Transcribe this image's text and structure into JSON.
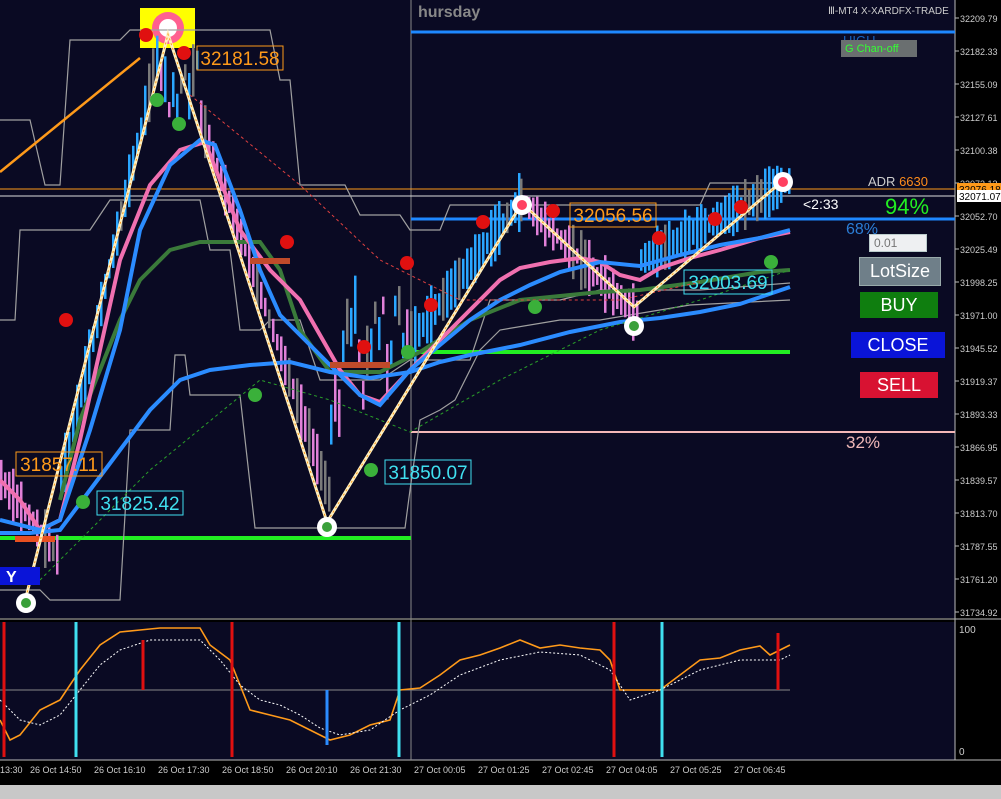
{
  "header": {
    "day_label": "hursday",
    "brand": "Ⅲ-MT4 X-XARDFX-TRADE"
  },
  "price_axis": {
    "labels": [
      "32209.79",
      "32182.33",
      "32155.09",
      "32127.61",
      "32100.38",
      "32073.13",
      "32052.70",
      "32025.49",
      "31998.25",
      "31971.00",
      "31945.52",
      "31919.37",
      "31893.33",
      "31866.95",
      "31839.57",
      "31813.70",
      "31787.55",
      "31761.20",
      "31734.92"
    ],
    "highlight_label": "32076.18",
    "current_label": "32071.07"
  },
  "indicator_axis": {
    "top_label": "100",
    "bottom_label": "0"
  },
  "time_axis": {
    "labels": [
      "13:30",
      "26 Oct 14:50",
      "26 Oct 16:10",
      "26 Oct 17:30",
      "26 Oct 18:50",
      "26 Oct 20:10",
      "26 Oct 21:30",
      "27 Oct 00:05",
      "27 Oct 01:25",
      "27 Oct 02:45",
      "27 Oct 04:05",
      "27 Oct 05:25",
      "27 Oct 06:45"
    ]
  },
  "price_labels": {
    "high_1": "32181.58",
    "high_2": "32056.56",
    "low_left": "31857.11",
    "low_1": "31825.42",
    "low_2": "31850.07",
    "low_3": "32003.69"
  },
  "panel": {
    "adr_label": "ADR",
    "adr_value": "6630",
    "timer": "<2:33",
    "pct_top": "94%",
    "pct_mid": "68%",
    "pct_low": "32%",
    "high_text": "HIGH",
    "chan_badge": "G  Chan-off",
    "lot_placeholder": "0.01",
    "lotsize_label": "LotSize",
    "buy_label": "BUY",
    "close_label": "CLOSE",
    "sell_label": "SELL",
    "left_tag": "Y"
  },
  "colors": {
    "background": "#000000",
    "chart_bg": "#0a0a23",
    "up_bar": "#2aa6ff",
    "down_bar": "#e080d8",
    "neutral_bar": "#7a7a7a",
    "zigzag": "#fff0c0",
    "ma_fast": "#f070b0",
    "ma_slow": "#2b8cff",
    "ma_green": "#3a7a3a",
    "support_line": "#22ee22",
    "resistance_line": "#1e88ff",
    "pivot_line": "#f4b8b8",
    "envelope": "#a0a0a0",
    "orange_line": "#ff9a1a"
  },
  "chart_data": {
    "type": "line",
    "title": "",
    "ylim": [
      31734.92,
      32209.79
    ],
    "zigzag_points": [
      {
        "x": "26 Oct 13:30",
        "y": 31750
      },
      {
        "x": "26 Oct 17:05",
        "y": 32200
      },
      {
        "x": "26 Oct 20:20",
        "y": 31810
      },
      {
        "x": "27 Oct 01:15",
        "y": 32065
      },
      {
        "x": "27 Oct 03:55",
        "y": 31982
      },
      {
        "x": "27 Oct 07:00",
        "y": 32083
      }
    ]
  }
}
